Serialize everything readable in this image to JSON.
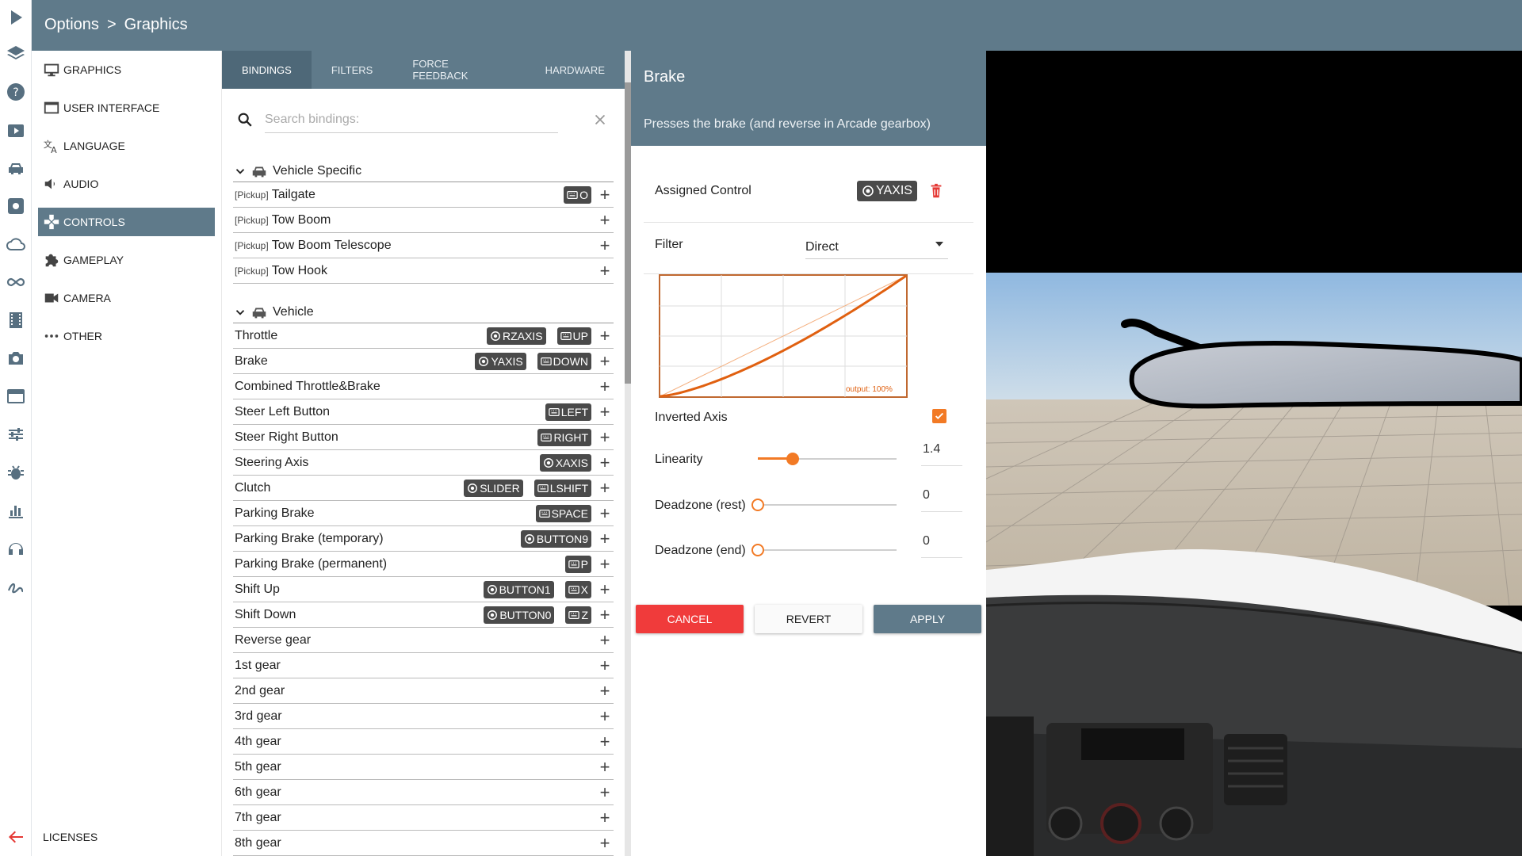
{
  "breadcrumb": {
    "root": "Options",
    "separator": ">",
    "current": "Graphics"
  },
  "categories": [
    {
      "label": "GRAPHICS",
      "icon": "monitor-icon",
      "active": false
    },
    {
      "label": "USER INTERFACE",
      "icon": "window-icon",
      "active": false
    },
    {
      "label": "LANGUAGE",
      "icon": "translate-icon",
      "active": false
    },
    {
      "label": "AUDIO",
      "icon": "speaker-icon",
      "active": false
    },
    {
      "label": "CONTROLS",
      "icon": "gamepad-icon",
      "active": true
    },
    {
      "label": "GAMEPLAY",
      "icon": "puzzle-icon",
      "active": false
    },
    {
      "label": "CAMERA",
      "icon": "video-camera-icon",
      "active": false
    },
    {
      "label": "OTHER",
      "icon": "more-icon",
      "active": false
    }
  ],
  "licenses_label": "LICENSES",
  "tabs": [
    {
      "label": "BINDINGS",
      "active": true
    },
    {
      "label": "FILTERS",
      "active": false
    },
    {
      "label": "FORCE FEEDBACK",
      "active": false
    },
    {
      "label": "HARDWARE",
      "active": false
    }
  ],
  "search": {
    "placeholder": "Search bindings:",
    "value": ""
  },
  "groups": [
    {
      "title": "Vehicle Specific",
      "rows": [
        {
          "prefix": "[Pickup]",
          "label": "Tailgate",
          "bindings": [
            {
              "type": "key",
              "label": "O"
            }
          ]
        },
        {
          "prefix": "[Pickup]",
          "label": "Tow Boom",
          "bindings": []
        },
        {
          "prefix": "[Pickup]",
          "label": "Tow Boom Telescope",
          "bindings": []
        },
        {
          "prefix": "[Pickup]",
          "label": "Tow Hook",
          "bindings": []
        }
      ]
    },
    {
      "title": "Vehicle",
      "rows": [
        {
          "prefix": "",
          "label": "Throttle",
          "bindings": [
            {
              "type": "axis",
              "label": "RZAXIS"
            },
            {
              "type": "key",
              "label": "UP"
            }
          ]
        },
        {
          "prefix": "",
          "label": "Brake",
          "bindings": [
            {
              "type": "axis",
              "label": "YAXIS"
            },
            {
              "type": "key",
              "label": "DOWN"
            }
          ]
        },
        {
          "prefix": "",
          "label": "Combined Throttle&Brake",
          "bindings": []
        },
        {
          "prefix": "",
          "label": "Steer Left Button",
          "bindings": [
            {
              "type": "key",
              "label": "LEFT"
            }
          ]
        },
        {
          "prefix": "",
          "label": "Steer Right Button",
          "bindings": [
            {
              "type": "key",
              "label": "RIGHT"
            }
          ]
        },
        {
          "prefix": "",
          "label": "Steering Axis",
          "bindings": [
            {
              "type": "axis",
              "label": "XAXIS"
            }
          ]
        },
        {
          "prefix": "",
          "label": "Clutch",
          "bindings": [
            {
              "type": "axis",
              "label": "SLIDER"
            },
            {
              "type": "key",
              "label": "LSHIFT"
            }
          ]
        },
        {
          "prefix": "",
          "label": "Parking Brake",
          "bindings": [
            {
              "type": "key",
              "label": "SPACE"
            }
          ]
        },
        {
          "prefix": "",
          "label": "Parking Brake (temporary)",
          "bindings": [
            {
              "type": "axis",
              "label": "BUTTON9"
            }
          ]
        },
        {
          "prefix": "",
          "label": "Parking Brake (permanent)",
          "bindings": [
            {
              "type": "key",
              "label": "P"
            }
          ]
        },
        {
          "prefix": "",
          "label": "Shift Up",
          "bindings": [
            {
              "type": "axis",
              "label": "BUTTON1"
            },
            {
              "type": "key",
              "label": "X"
            }
          ]
        },
        {
          "prefix": "",
          "label": "Shift Down",
          "bindings": [
            {
              "type": "axis",
              "label": "BUTTON0"
            },
            {
              "type": "key",
              "label": "Z"
            }
          ]
        },
        {
          "prefix": "",
          "label": "Reverse gear",
          "bindings": []
        },
        {
          "prefix": "",
          "label": "1st gear",
          "bindings": []
        },
        {
          "prefix": "",
          "label": "2nd gear",
          "bindings": []
        },
        {
          "prefix": "",
          "label": "3rd gear",
          "bindings": []
        },
        {
          "prefix": "",
          "label": "4th gear",
          "bindings": []
        },
        {
          "prefix": "",
          "label": "5th gear",
          "bindings": []
        },
        {
          "prefix": "",
          "label": "6th gear",
          "bindings": []
        },
        {
          "prefix": "",
          "label": "7th gear",
          "bindings": []
        },
        {
          "prefix": "",
          "label": "8th gear",
          "bindings": []
        }
      ]
    }
  ],
  "details": {
    "title": "Brake",
    "description": "Presses the brake (and reverse in Arcade gearbox)",
    "assigned_label": "Assigned Control",
    "assigned_value": "YAXIS",
    "filter_label": "Filter",
    "filter_value": "Direct",
    "curve_caption": "output: 100%",
    "inverted_label": "Inverted Axis",
    "inverted_checked": true,
    "linearity_label": "Linearity",
    "linearity_value": "1.4",
    "linearity_fraction": 0.25,
    "deadzone_rest_label": "Deadzone (rest)",
    "deadzone_rest_value": "0",
    "deadzone_rest_fraction": 0,
    "deadzone_end_label": "Deadzone (end)",
    "deadzone_end_value": "0",
    "deadzone_end_fraction": 0,
    "cancel_label": "CANCEL",
    "revert_label": "REVERT",
    "apply_label": "APPLY"
  },
  "colors": {
    "header": "#5f7a8a",
    "accent": "#f27a25",
    "cancel": "#f03b3b",
    "chip": "#4a4a4a"
  }
}
